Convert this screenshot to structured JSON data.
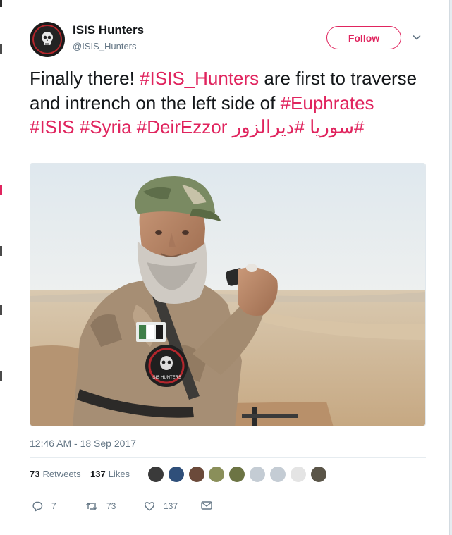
{
  "user": {
    "name": "ISIS Hunters",
    "handle": "@ISIS_Hunters",
    "avatar_text": "ISIS HUNTERS"
  },
  "follow_label": "Follow",
  "tweet": {
    "text_plain_1": "Finally there! ",
    "hashtag_1": "#ISIS_Hunters",
    "text_plain_2": " are first to traverse and intrench on the left side of ",
    "hashtag_2": "#Euphrates",
    "hashtag_3": "#ISIS",
    "hashtag_4": "#Syria",
    "hashtag_5": "#DeirEzzor",
    "hashtag_6": "#ديرالزور",
    "hashtag_7": "#سوريا"
  },
  "photo": {
    "patch_text": "ISIS HUNTERS"
  },
  "timestamp": "12:46 AM - 18 Sep 2017",
  "stats": {
    "retweets_count": "73",
    "retweets_label": "Retweets",
    "likes_count": "137",
    "likes_label": "Likes"
  },
  "actions": {
    "reply_count": "7",
    "retweet_count": "73",
    "like_count": "137"
  },
  "colors": {
    "accent": "#e0245e",
    "muted": "#657786",
    "text": "#14171a"
  },
  "icons": [
    "skull-logo",
    "chevron-down-icon",
    "reply-icon",
    "retweet-icon",
    "heart-icon",
    "envelope-icon"
  ]
}
